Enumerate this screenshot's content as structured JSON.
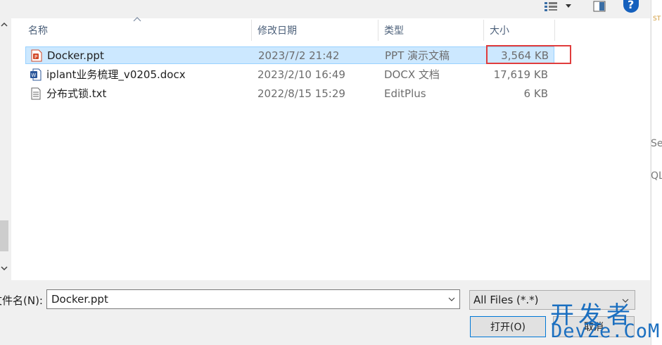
{
  "toolbar": {
    "view_icon": "view-options-icon",
    "dropdown_icon": "chevron-down-icon",
    "preview_icon": "preview-pane-icon",
    "help_label": "?"
  },
  "columns": {
    "name": "名称",
    "modified": "修改日期",
    "type": "类型",
    "size": "大小"
  },
  "files": [
    {
      "icon": "ppt-file-icon",
      "name": "Docker.ppt",
      "modified": "2023/7/2 21:42",
      "type": "PPT 演示文稿",
      "size": "3,564 KB",
      "selected": true
    },
    {
      "icon": "word-file-icon",
      "name": "iplant业务梳理_v0205.docx",
      "modified": "2023/2/10 16:49",
      "type": "DOCX 文档",
      "size": "17,619 KB",
      "selected": false
    },
    {
      "icon": "text-file-icon",
      "name": "分布式锁.txt",
      "modified": "2022/8/15 15:29",
      "type": "EditPlus",
      "size": "6 KB",
      "selected": false
    }
  ],
  "filename": {
    "label": "文件名(N):",
    "value": "Docker.ppt"
  },
  "filetype": {
    "selected": "All Files (*.*)"
  },
  "buttons": {
    "open": "打开(O)",
    "cancel": "取消"
  },
  "background_app": {
    "top_text": "ST",
    "text_1": "Se",
    "text_2": "QL"
  },
  "watermark": {
    "line1": "开发者",
    "line2": "DevZe.CoM"
  },
  "colors": {
    "selection": "#cce8ff",
    "highlight_box": "#e03c3c",
    "accent": "#0078d7",
    "watermark": "#1b6fc0"
  }
}
